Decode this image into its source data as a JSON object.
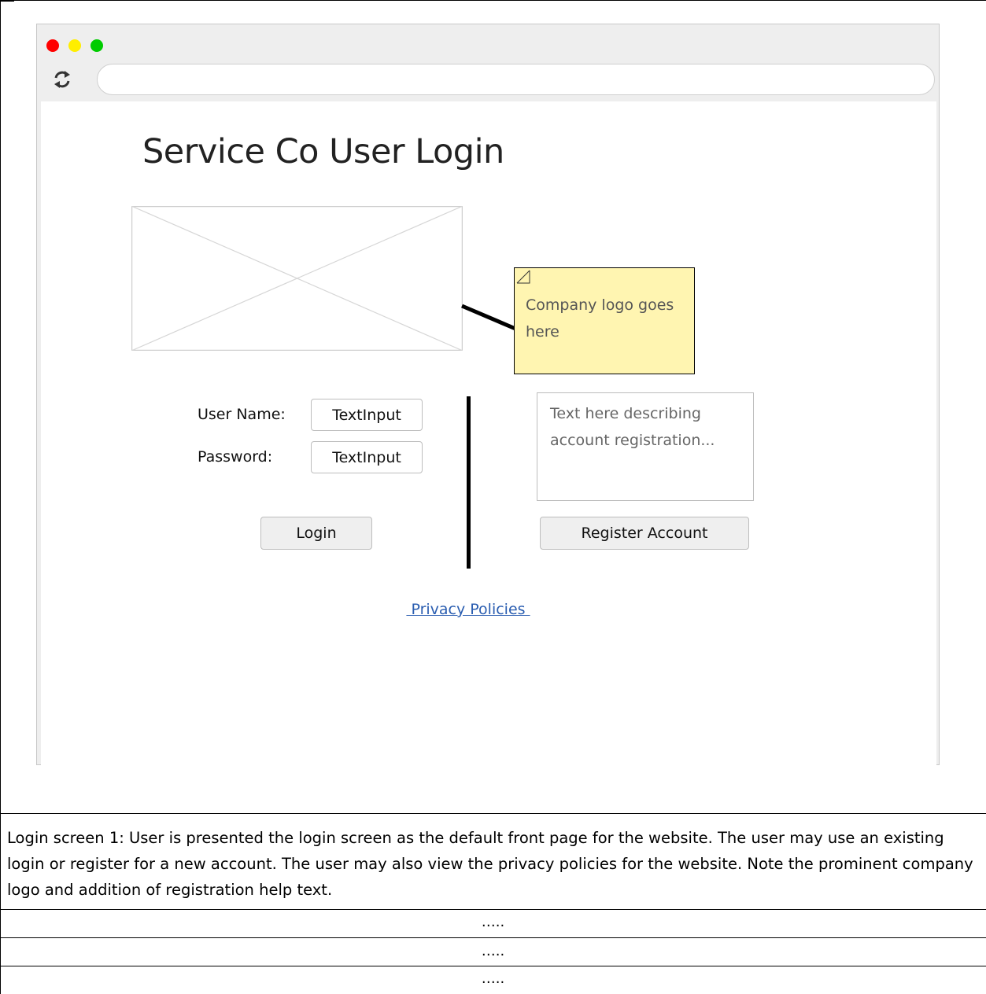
{
  "browser": {
    "window_controls": [
      {
        "name": "close",
        "color": "#ff0000"
      },
      {
        "name": "minimize",
        "color": "#ffee00"
      },
      {
        "name": "maximize",
        "color": "#00cc00"
      }
    ],
    "reload_icon": "reload-icon",
    "url": ""
  },
  "login_page": {
    "title": "Service Co User Login",
    "logo_placeholder_icon": "image-placeholder-icon",
    "note": "Company logo goes here",
    "username_label": "User Name:",
    "username_value": "TextInput",
    "password_label": "Password:",
    "password_value": "TextInput",
    "login_button": "Login",
    "registration_text": "Text here describing account registration...",
    "register_button": "Register Account",
    "privacy_link": " Privacy Policies "
  },
  "caption": "Login screen 1: User is presented the login screen as the default front page for the website.  The user may use an existing login or register for a new account.  The user may also view the privacy policies for the website.  Note the prominent company logo and addition of registration help text.",
  "table_rows": [
    "…..",
    "…..",
    "….."
  ]
}
